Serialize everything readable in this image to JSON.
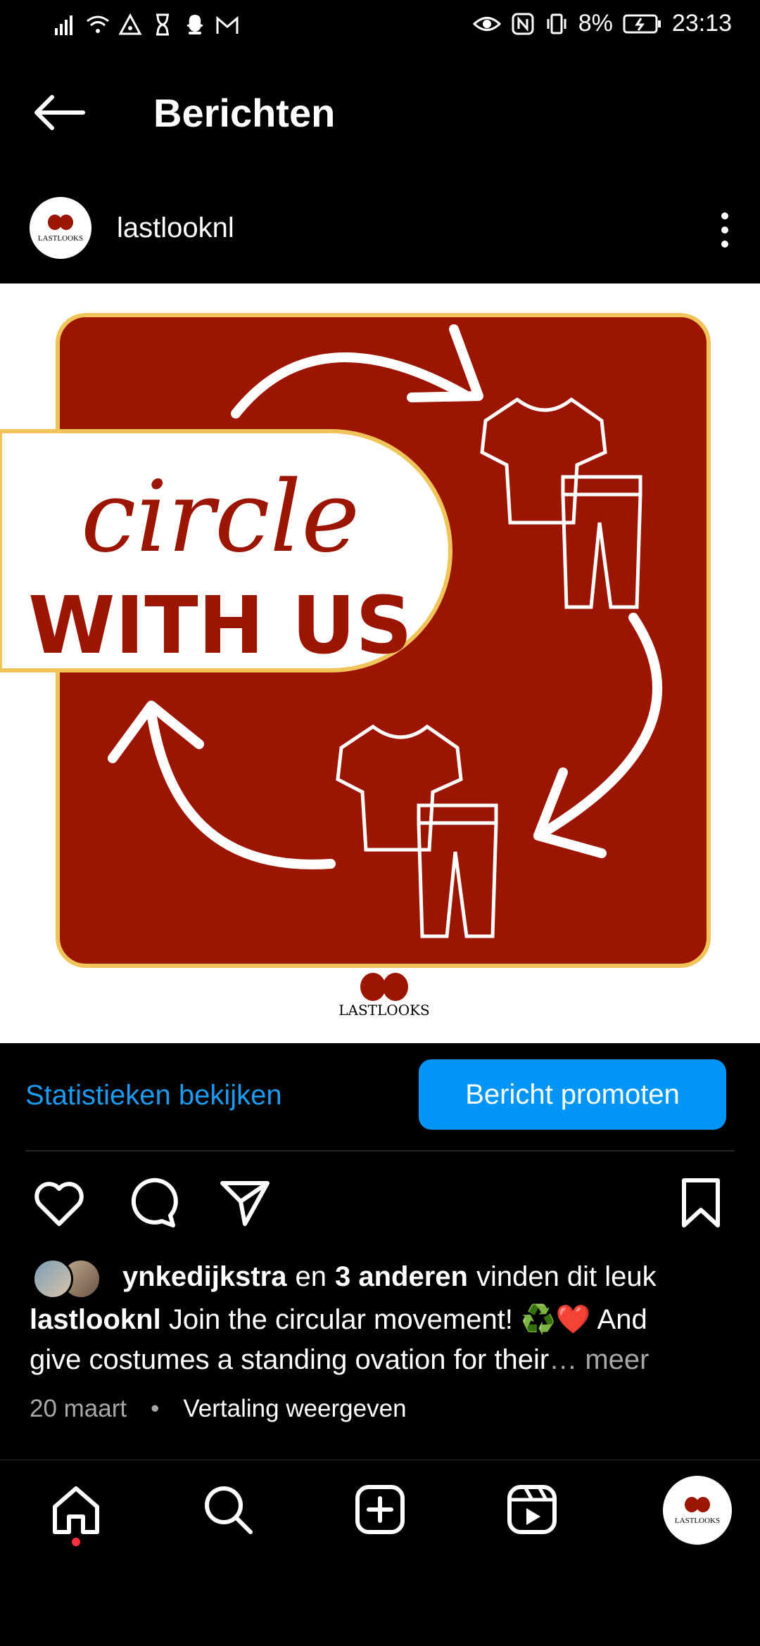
{
  "status_bar": {
    "battery": "8%",
    "time": "23:13",
    "left_icons": [
      "signal-icon",
      "wifi-icon",
      "hotspot-icon",
      "hourglass-icon",
      "snapchat-icon",
      "gmail-icon"
    ],
    "right_icons": [
      "eye-icon",
      "nfc-icon",
      "vibrate-icon",
      "battery-icon"
    ]
  },
  "header": {
    "title": "Berichten"
  },
  "post": {
    "username": "lastlooknl",
    "image": {
      "script_text": "circle",
      "bold_text": "WITH US",
      "logo_text": "LASTLOOKS",
      "brand_color": "#9b1500",
      "border_color": "#f1c45a"
    },
    "stats_link": "Statistieken bekijken",
    "promote_button": "Bericht promoten",
    "likes": {
      "user": "ynkedijkstra",
      "and": "en",
      "others": "3 anderen",
      "suffix": "vinden dit leuk"
    },
    "caption": {
      "username": "lastlooknl",
      "line1": "Join the circular movement! ♻️❤️ And",
      "line2": "give costumes a standing ovation for their",
      "ellipsis": "…",
      "more": "meer"
    },
    "date": "20 maart",
    "translate": "Vertaling weergeven"
  },
  "nav": [
    "home-icon",
    "search-icon",
    "create-icon",
    "reels-icon",
    "profile-avatar"
  ],
  "colors": {
    "accent": "#0095f6",
    "link": "#1d9bf0",
    "notification": "#ff3040"
  }
}
